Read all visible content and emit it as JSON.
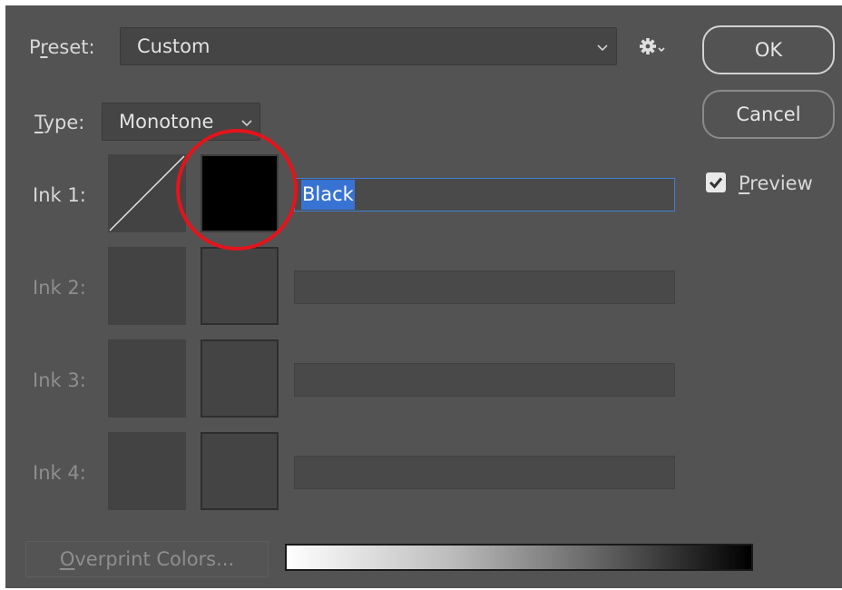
{
  "preset": {
    "label_prefix": "P",
    "label_underlined": "r",
    "label_suffix": "eset:",
    "value": "Custom"
  },
  "type": {
    "label_underlined": "T",
    "label_suffix": "ype:",
    "value": "Monotone"
  },
  "buttons": {
    "ok": "OK",
    "cancel": "Cancel"
  },
  "preview": {
    "label_underlined": "P",
    "label_suffix": "review",
    "checked": true
  },
  "inks": [
    {
      "label": "Ink 1:",
      "name": "Black",
      "enabled": true,
      "color": "#000000"
    },
    {
      "label": "Ink 2:",
      "name": "",
      "enabled": false
    },
    {
      "label": "Ink 3:",
      "name": "",
      "enabled": false
    },
    {
      "label": "Ink 4:",
      "name": "",
      "enabled": false
    }
  ],
  "overprint": {
    "label_underlined": "O",
    "label_suffix": "verprint Colors..."
  },
  "icons": {
    "preset_chevron": "chevron-down-icon",
    "type_chevron": "chevron-down-icon",
    "settings": "gear-icon",
    "preview_check": "checkmark-icon"
  },
  "colors": {
    "dialog_bg": "#535353",
    "selection": "#3873d4",
    "focus_border": "#3e7fd6",
    "highlight_ring": "#e4141b"
  }
}
